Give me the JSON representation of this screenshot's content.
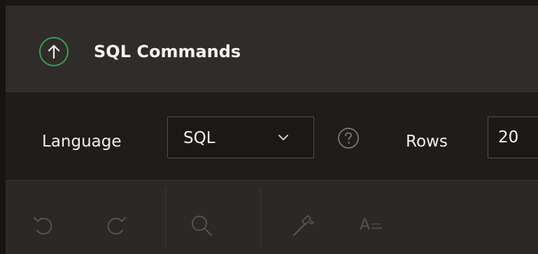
{
  "header": {
    "title": "SQL Commands",
    "icon": "arrow-up-circle-icon",
    "icon_color": "#3d9a5a"
  },
  "settings": {
    "language_label": "Language",
    "language_value": "SQL",
    "help_icon": "help-icon",
    "rows_label": "Rows",
    "rows_value": "20"
  },
  "toolbar": {
    "buttons": [
      {
        "name": "undo",
        "icon": "undo-icon",
        "enabled": false
      },
      {
        "name": "redo",
        "icon": "redo-icon",
        "enabled": false
      },
      {
        "name": "find",
        "icon": "search-icon",
        "enabled": false
      },
      {
        "name": "autocomplete",
        "icon": "hammer-icon",
        "enabled": false
      },
      {
        "name": "format",
        "icon": "format-text-icon",
        "enabled": false
      }
    ],
    "format_glyph": "A"
  },
  "colors": {
    "header_bg": "#2f2c29",
    "bar_bg": "#1e1d1b",
    "toolbar_bg": "#2b2926",
    "disabled_icon": "#57534d",
    "accent_green": "#3d9a5a"
  }
}
